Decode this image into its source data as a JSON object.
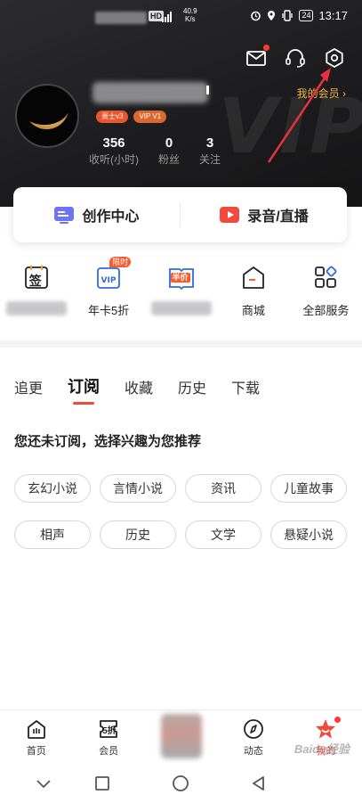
{
  "status_bar": {
    "hd": "HD",
    "signal": "5G",
    "net_speed_value": "40.9",
    "net_speed_unit": "K/s",
    "battery": "24",
    "time": "13:17"
  },
  "header": {
    "tags": [
      "贵士v3",
      "VIP V1"
    ],
    "member_link": "我的会员",
    "stats": [
      {
        "value": "356",
        "label": "收听(小时)"
      },
      {
        "value": "0",
        "label": "粉丝"
      },
      {
        "value": "3",
        "label": "关注"
      }
    ],
    "watermark": "VIP"
  },
  "card": {
    "create": "创作中心",
    "live": "录音/直播"
  },
  "shortcuts": {
    "sign_glyph": "签",
    "vip_card_label": "年卡5折",
    "vip_card_badge": "限时",
    "half_price_badge": "半价",
    "mall": "商城",
    "all_services": "全部服务"
  },
  "tabs": [
    "追更",
    "订阅",
    "收藏",
    "历史",
    "下载"
  ],
  "empty_headline": "您还未订阅，选择兴趣为您推荐",
  "chips": [
    "玄幻小说",
    "言情小说",
    "资讯",
    "儿童故事",
    "相声",
    "历史",
    "文学",
    "悬疑小说"
  ],
  "bottom_nav": {
    "home": "首页",
    "member": "会员",
    "member_icon_text": "5折",
    "dynamic": "动态",
    "mine": "我的"
  },
  "watermark_text": "Baidu经验",
  "colors": {
    "accent": "#f14a3b",
    "gold": "#f3b24a",
    "header_bg": "#1d1d1f"
  }
}
